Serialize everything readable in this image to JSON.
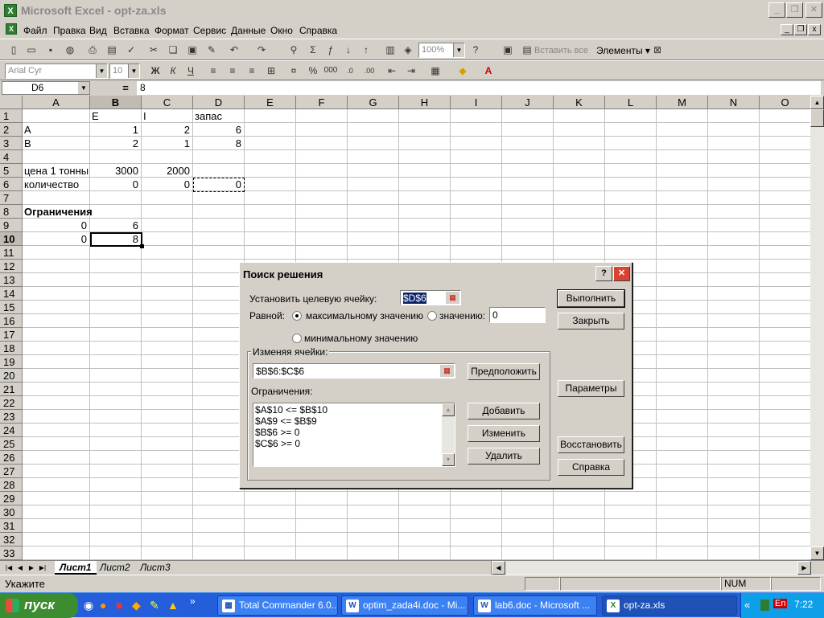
{
  "window": {
    "title": "Microsoft Excel - opt-za.xls",
    "min_label": "_",
    "max_label": "❐",
    "close_label": "✕"
  },
  "menu": [
    "Файл",
    "Правка",
    "Вид",
    "Вставка",
    "Формат",
    "Сервис",
    "Данные",
    "Окно",
    "Справка"
  ],
  "toolbar": {
    "zoom": "100%",
    "insert_all_label": "Вставить все",
    "elements_label": "Элементы ▾",
    "font": "Arial Cyr",
    "font_size": "10"
  },
  "formula_bar": {
    "name_box": "D6",
    "equals": "=",
    "value": "8"
  },
  "columns": [
    "A",
    "B",
    "C",
    "D",
    "E",
    "F",
    "G",
    "H",
    "I",
    "J",
    "K",
    "L",
    "M",
    "N",
    "O"
  ],
  "rows": [
    "1",
    "2",
    "3",
    "4",
    "5",
    "6",
    "7",
    "8",
    "9",
    "10",
    "11",
    "12",
    "13",
    "14",
    "15",
    "16",
    "17",
    "18",
    "19",
    "20",
    "21",
    "22",
    "23",
    "24",
    "25",
    "26",
    "27",
    "28",
    "29",
    "30",
    "31",
    "32",
    "33"
  ],
  "cells": {
    "B1": "E",
    "C1": "I",
    "D1": "запас",
    "A2": "A",
    "B2": "1",
    "C2": "2",
    "D2": "6",
    "A3": "B",
    "B3": "2",
    "C3": "1",
    "D3": "8",
    "A5": "цена 1 тонны",
    "B5": "3000",
    "C5": "2000",
    "A6": "количество",
    "B6": "0",
    "C6": "0",
    "D6": "0",
    "A8": "Ограничения",
    "A9": "0",
    "B9": "6",
    "A10": "0",
    "B10": "8"
  },
  "sheets": [
    "Лист1",
    "Лист2",
    "Лист3"
  ],
  "status": {
    "text": "Укажите",
    "num": "NUM"
  },
  "solver": {
    "title": "Поиск решения",
    "help_label": "?",
    "close_label": "✕",
    "target_label": "Установить целевую ячейку:",
    "target_value": "$D$6",
    "equal_label": "Равной:",
    "max_label": "максимальному значению",
    "value_label": "значению:",
    "value_field": "0",
    "min_label": "минимальному значению",
    "changing_label": "Изменяя ячейки:",
    "changing_value": "$B$6:$C$6",
    "guess_label": "Предположить",
    "constraints_label": "Ограничения:",
    "constraints": [
      "$A$10 <= $B$10",
      "$A$9 <= $B$9",
      "$B$6 >= 0",
      "$C$6 >= 0"
    ],
    "add_label": "Добавить",
    "change_label": "Изменить",
    "delete_label": "Удалить",
    "solve_label": "Выполнить",
    "close_btn_label": "Закрыть",
    "options_label": "Параметры",
    "reset_label": "Восстановить",
    "help_btn_label": "Справка"
  },
  "taskbar": {
    "start_label": "пуск",
    "tasks": [
      "Total Commander 6.0...",
      "optim_zada4i.doc - Mi...",
      "lab6.doc - Microsoft ...",
      "opt-za.xls"
    ],
    "lang": "En",
    "time": "7:22"
  }
}
